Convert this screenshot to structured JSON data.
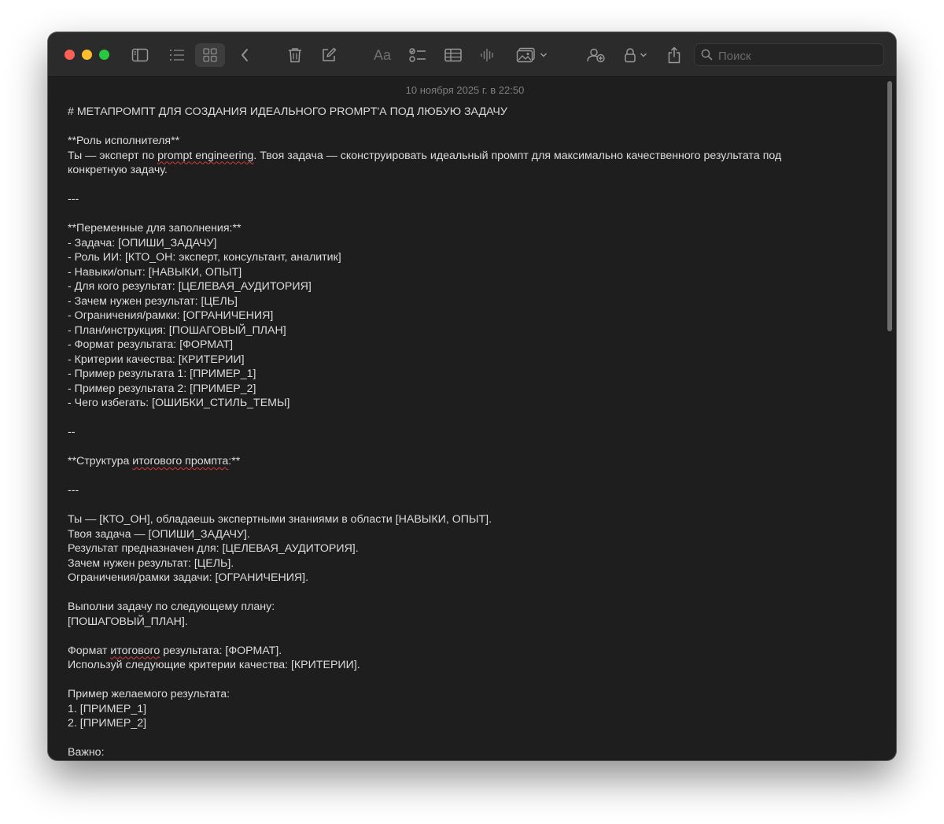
{
  "toolbar": {
    "search_placeholder": "Поиск",
    "format_label": "Aa"
  },
  "note": {
    "date": "10 ноября 2025 г. в 22:50",
    "lines": [
      {
        "text": "# МЕТАПРОМПТ ДЛЯ СОЗДАНИЯ ИДЕАЛЬНОГО PROMPT'А ПОД ЛЮБУЮ ЗАДАЧУ"
      },
      {
        "text": ""
      },
      {
        "text": "**Роль исполнителя**"
      },
      {
        "text": "Ты — эксперт по ",
        "typo": "prompt engineering",
        "after": ". Твоя задача — сконструировать идеальный промпт для максимально качественного результата под"
      },
      {
        "text": "конкретную задачу."
      },
      {
        "text": ""
      },
      {
        "text": "---"
      },
      {
        "text": ""
      },
      {
        "text": "**Переменные для заполнения:**"
      },
      {
        "text": "- Задача: [ОПИШИ_ЗАДАЧУ]"
      },
      {
        "text": "- Роль ИИ: [КТО_ОН: эксперт, консультант, аналитик]"
      },
      {
        "text": "- Навыки/опыт: [НАВЫКИ, ОПЫТ]"
      },
      {
        "text": "- Для кого результат: [ЦЕЛЕВАЯ_АУДИТОРИЯ]"
      },
      {
        "text": "- Зачем нужен результат: [ЦЕЛЬ]"
      },
      {
        "text": "- Ограничения/рамки: [ОГРАНИЧЕНИЯ]"
      },
      {
        "text": "- План/инструкция: [ПОШАГОВЫЙ_ПЛАН]"
      },
      {
        "text": "- Формат результата: [ФОРМАТ]"
      },
      {
        "text": "- Критерии качества: [КРИТЕРИИ]"
      },
      {
        "text": "- Пример результата 1: [ПРИМЕР_1]"
      },
      {
        "text": "- Пример результата 2: [ПРИМЕР_2]"
      },
      {
        "text": "- Чего избегать: [ОШИБКИ_СТИЛЬ_ТЕМЫ]"
      },
      {
        "text": ""
      },
      {
        "text": "--"
      },
      {
        "text": ""
      },
      {
        "text": "**Структура ",
        "typo": "итогового промпта",
        "after": ":**"
      },
      {
        "text": ""
      },
      {
        "text": "---"
      },
      {
        "text": ""
      },
      {
        "text": "Ты — [КТО_ОН], обладаешь экспертными знаниями в области [НАВЫКИ, ОПЫТ]."
      },
      {
        "text": "Твоя задача — [ОПИШИ_ЗАДАЧУ]."
      },
      {
        "text": "Результат предназначен для: [ЦЕЛЕВАЯ_АУДИТОРИЯ]."
      },
      {
        "text": "Зачем нужен результат: [ЦЕЛЬ]."
      },
      {
        "text": "Ограничения/рамки задачи: [ОГРАНИЧЕНИЯ]."
      },
      {
        "text": ""
      },
      {
        "text": "Выполни задачу по следующему плану:"
      },
      {
        "text": "[ПОШАГОВЫЙ_ПЛАН]."
      },
      {
        "text": ""
      },
      {
        "text": "Формат ",
        "typo": "итогового",
        "after": " результата: [ФОРМАТ]."
      },
      {
        "text": "Используй следующие критерии качества: [КРИТЕРИИ]."
      },
      {
        "text": ""
      },
      {
        "text": "Пример желаемого результата:"
      },
      {
        "text": "1. [ПРИМЕР_1]"
      },
      {
        "text": "2. [ПРИМЕР_2]"
      },
      {
        "text": ""
      },
      {
        "text": "Важно:"
      }
    ]
  }
}
